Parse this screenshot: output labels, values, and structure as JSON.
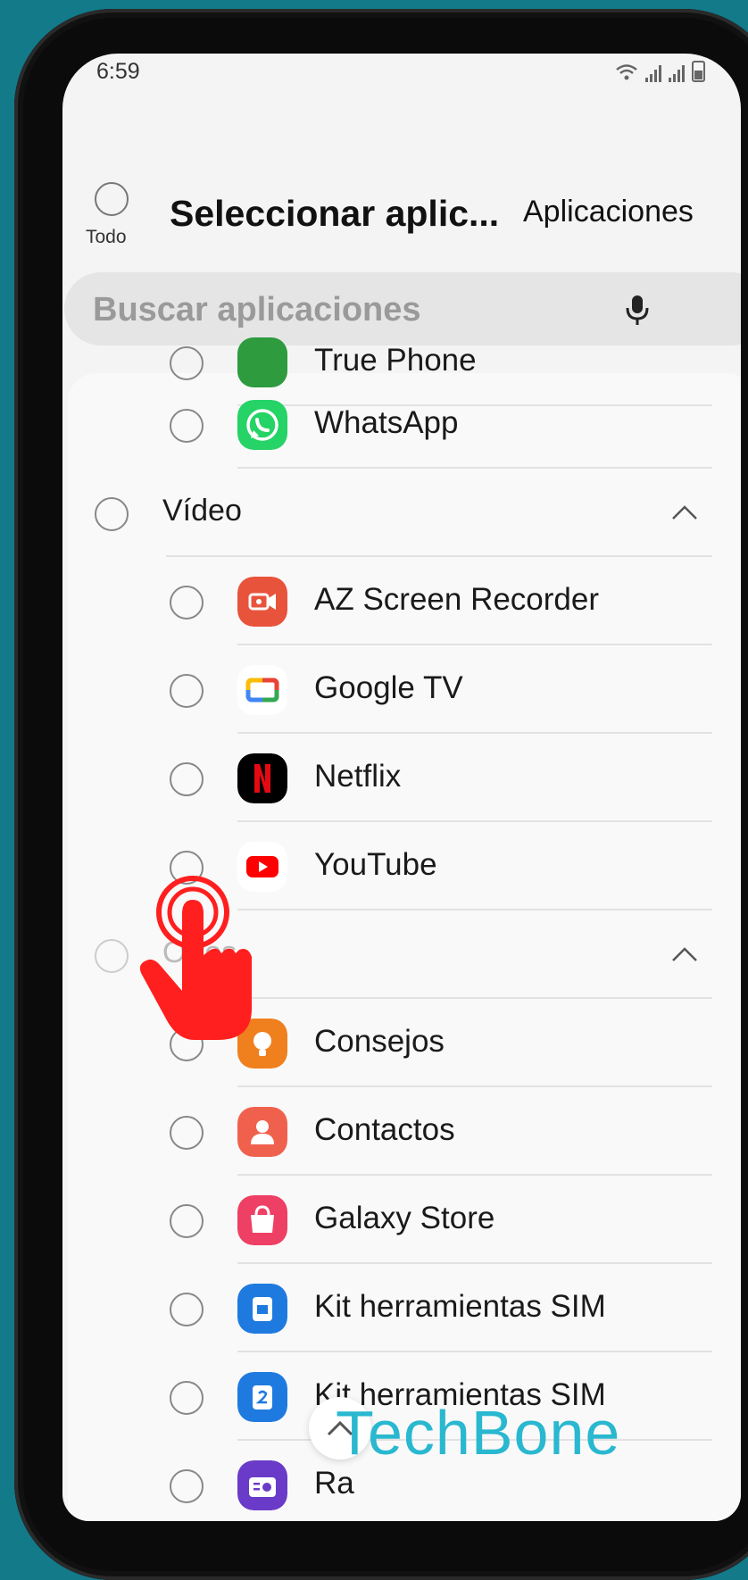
{
  "status": {
    "time": "6:59"
  },
  "header": {
    "select_all_label": "Todo",
    "title": "Seleccionar aplic...",
    "apps_link": "Aplicaciones"
  },
  "search": {
    "placeholder": "Buscar aplicaciones"
  },
  "sections": [
    {
      "type": "app",
      "label": "True Phone",
      "icon": "phone-icon",
      "color": "#2e9b3e"
    },
    {
      "type": "app",
      "label": "WhatsApp",
      "icon": "whatsapp-icon",
      "color": "#25d366"
    },
    {
      "type": "category",
      "label": "Vídeo"
    },
    {
      "type": "app",
      "label": "AZ Screen Recorder",
      "icon": "screen-recorder-icon",
      "color": "#e8533c"
    },
    {
      "type": "app",
      "label": "Google TV",
      "icon": "google-tv-icon",
      "color": "#ffffff"
    },
    {
      "type": "app",
      "label": "Netflix",
      "icon": "netflix-icon",
      "color": "#000000"
    },
    {
      "type": "app",
      "label": "YouTube",
      "icon": "youtube-icon",
      "color": "#ffffff"
    },
    {
      "type": "category",
      "label": "Otros"
    },
    {
      "type": "app",
      "label": "Consejos",
      "icon": "tips-icon",
      "color": "#f07f1e"
    },
    {
      "type": "app",
      "label": "Contactos",
      "icon": "contacts-icon",
      "color": "#f0614d"
    },
    {
      "type": "app",
      "label": "Galaxy Store",
      "icon": "galaxy-store-icon",
      "color": "#ee3f64"
    },
    {
      "type": "app",
      "label": "Kit herramientas SIM",
      "icon": "sim-toolkit-icon",
      "color": "#1f7ae0"
    },
    {
      "type": "app",
      "label": "Kit herramientas SIM",
      "icon": "sim-toolkit-2-icon",
      "color": "#1f7ae0"
    },
    {
      "type": "app",
      "label": "Ra",
      "icon": "radio-icon",
      "color": "#6a3bc8"
    }
  ],
  "watermark": "TechBone",
  "colors": {
    "background": "#137a8a",
    "accent_touch": "#ff1f1f",
    "watermark": "#29b8cf"
  }
}
